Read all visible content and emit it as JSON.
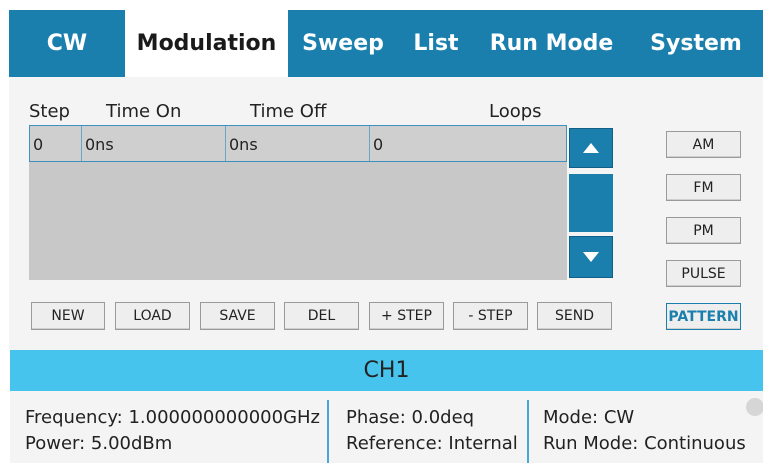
{
  "tabs": [
    "CW",
    "Modulation",
    "Sweep",
    "List",
    "Run Mode",
    "System"
  ],
  "active_tab": "Modulation",
  "table": {
    "columns": [
      "Step",
      "Time On",
      "Time Off",
      "Loops"
    ],
    "rows": [
      [
        "0",
        "0ns",
        "0ns",
        "0"
      ]
    ]
  },
  "buttons": [
    "NEW",
    "LOAD",
    "SAVE",
    "DEL",
    "+ STEP",
    "- STEP",
    "SEND"
  ],
  "modulation_types": [
    "AM",
    "FM",
    "PM",
    "PULSE",
    "PATTERN"
  ],
  "selected_modulation": "PATTERN",
  "channel": {
    "title": "CH1",
    "frequency": "Frequency: 1.000000000000GHz",
    "power": "Power: 5.00dBm",
    "phase": "Phase: 0.0deq",
    "reference": "Reference: Internal",
    "mode": "Mode: CW",
    "run_mode": "Run Mode: Continuous"
  },
  "colors": {
    "accent": "#1b7fad",
    "channel_header": "#47c4ee"
  },
  "icons": {
    "scroll_up": "triangle-up-icon",
    "scroll_down": "triangle-down-icon"
  }
}
